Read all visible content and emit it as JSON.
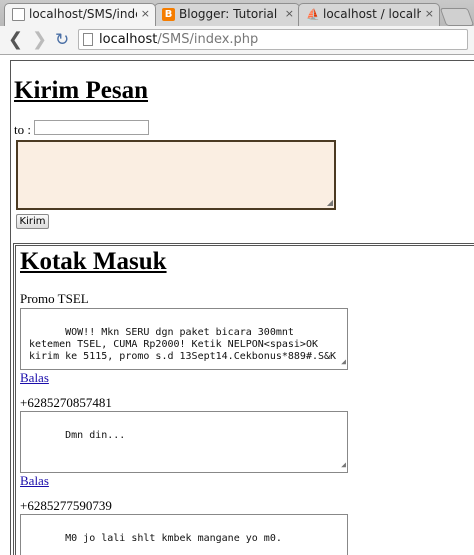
{
  "browser": {
    "tabs": [
      {
        "title": "localhost/SMS/index.p",
        "favicon": "page-icon",
        "active": true
      },
      {
        "title": "Blogger: Tutorial Mem",
        "favicon": "blogger-icon",
        "active": false
      },
      {
        "title": "localhost / localhost /",
        "favicon": "phpmyadmin-icon",
        "active": false
      }
    ],
    "close_glyph": "×",
    "address": {
      "host": "localhost",
      "path": "/SMS/index.php"
    }
  },
  "compose": {
    "heading": "Kirim Pesan",
    "to_label": "to :",
    "to_value": "",
    "message_value": "",
    "send_label": "Kirim"
  },
  "inbox": {
    "heading": "Kotak Masuk",
    "reply_label": "Balas",
    "messages": [
      {
        "sender": "Promo TSEL",
        "body": "WOW!! Mkn SERU dgn paket bicara 300mnt ketemen TSEL, CUMA Rp2000! Ketik NELPON<spasi>OK kirim ke 5115, promo s.d 13Sept14.Cekbonus*889#.S&K"
      },
      {
        "sender": "+6285270857481",
        "body": "Dmn din..."
      },
      {
        "sender": "+6285277590739",
        "body": "M0 jo lali shlt kmbek mangane yo m0."
      }
    ]
  }
}
